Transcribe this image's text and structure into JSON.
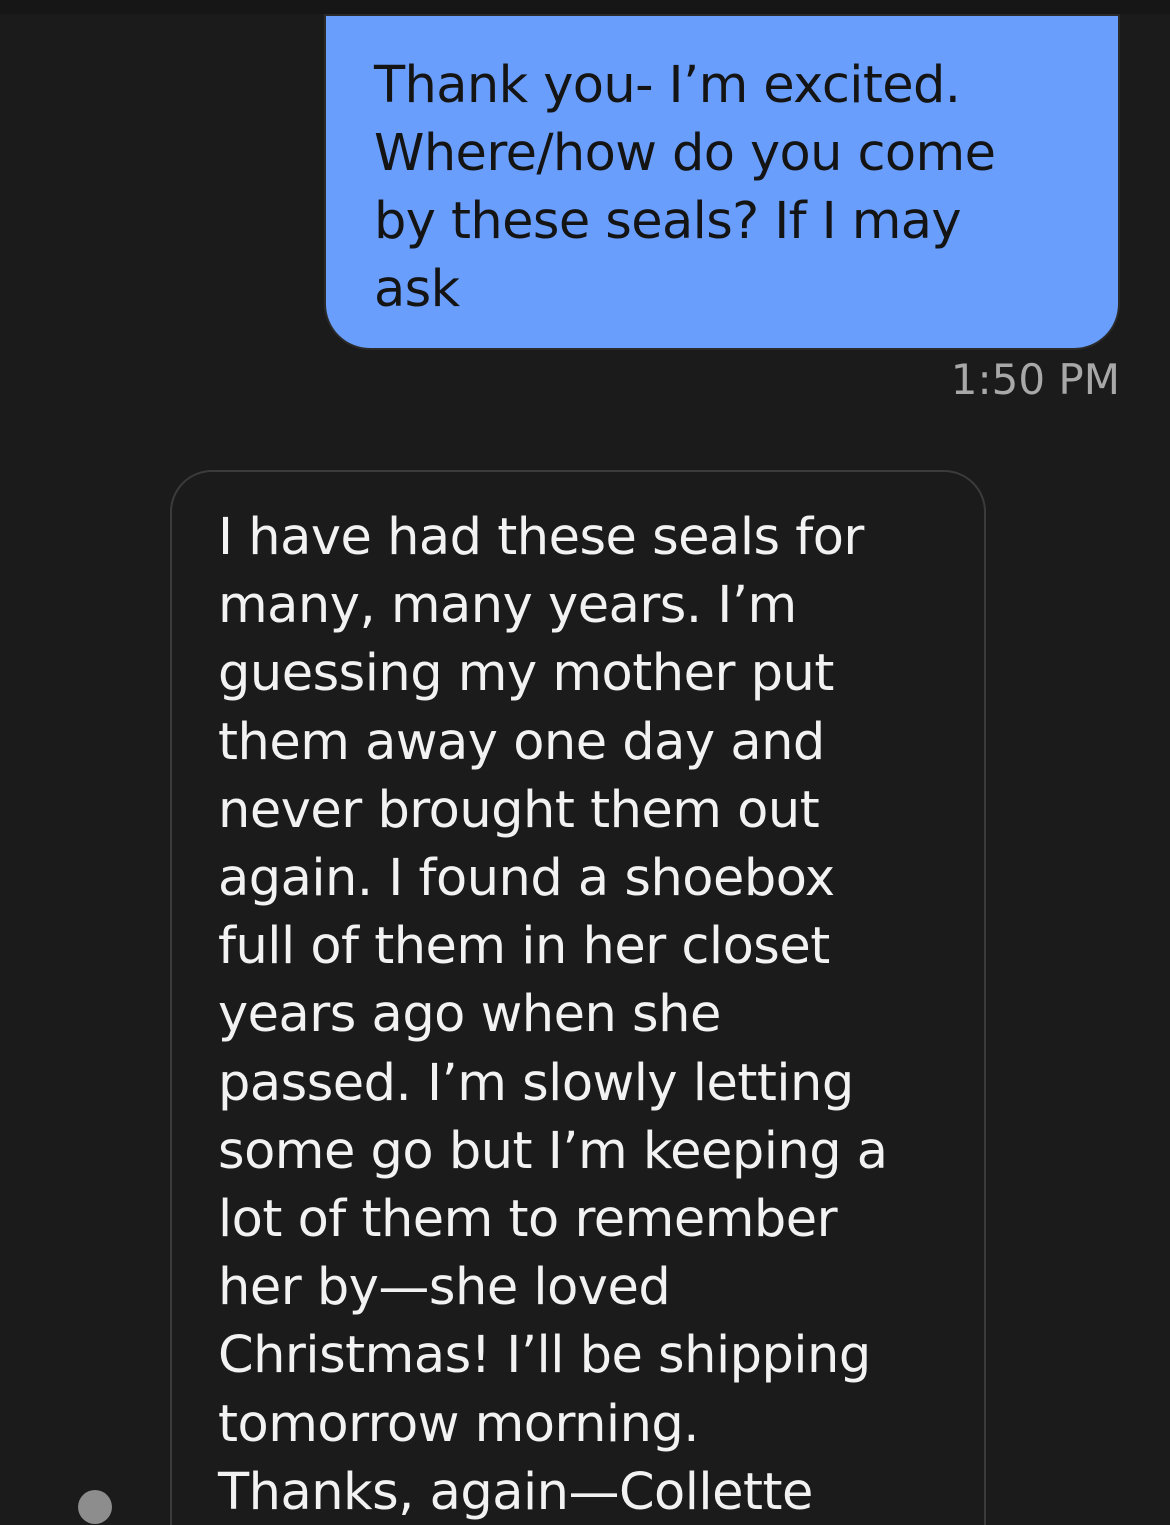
{
  "conversation": {
    "messages": [
      {
        "direction": "sent",
        "text": "Thank you- I’m excited.\nWhere/how do you come\nby these seals? If I may\nask",
        "time": "1:50 PM"
      },
      {
        "direction": "received",
        "text": "I have had these seals for\nmany, many years. I’m\nguessing my mother put\nthem away one day and\nnever brought them out\nagain. I found a shoebox\nfull of them in her closet\nyears ago when she\npassed. I’m slowly letting\nsome go but I’m keeping a\nlot of them to remember\nher by—she loved\nChristmas! I’ll be shipping\ntomorrow morning.\nThanks, again—Collette"
      }
    ]
  },
  "colors": {
    "background": "#1b1b1b",
    "sent_bubble": "#6a9efc",
    "received_bubble_border": "#3b3b3b",
    "timestamp": "#a8a8a8"
  }
}
